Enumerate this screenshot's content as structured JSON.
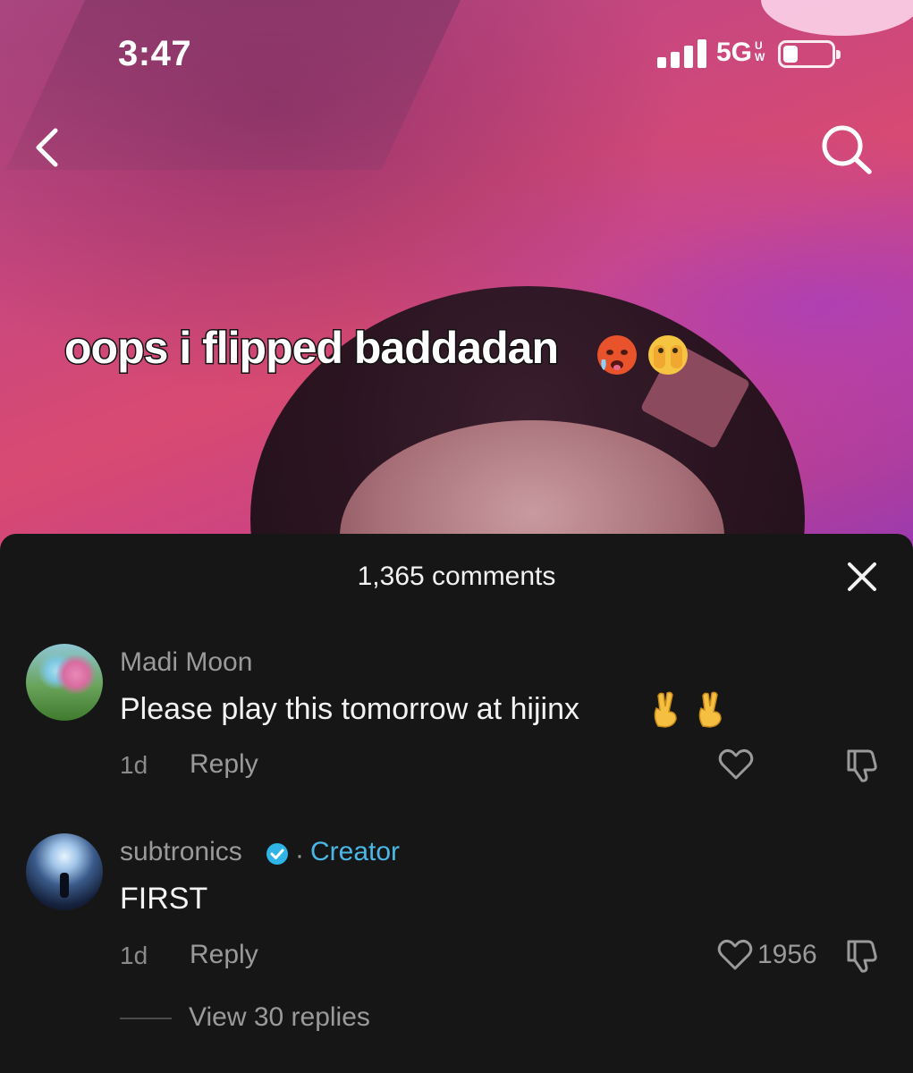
{
  "status_bar": {
    "time": "3:47",
    "network": "5G",
    "network_suffix": "UW",
    "battery_level": 0.3
  },
  "nav": {
    "back_icon": "chevron-left-icon",
    "search_icon": "search-icon"
  },
  "video": {
    "caption": "oops i flipped baddadan",
    "caption_emojis": [
      "hot-face-emoji",
      "face-peeking-emoji"
    ]
  },
  "comments_sheet": {
    "title": "1,365 comments",
    "close_icon": "close-icon",
    "comments": [
      {
        "username": "Madi Moon",
        "text": "Please play this tomorrow at hijinx",
        "emojis": [
          "crossed-fingers-emoji",
          "crossed-fingers-emoji"
        ],
        "time": "1d",
        "reply_label": "Reply",
        "like_count": ""
      },
      {
        "username": "subtronics",
        "verified": true,
        "separator": "·",
        "badge": "Creator",
        "text": "FIRST",
        "time": "1d",
        "reply_label": "Reply",
        "like_count": "1956",
        "view_replies": "View 30 replies"
      }
    ]
  },
  "colors": {
    "sheet_bg": "#161616",
    "creator_blue": "#4bb7e6",
    "muted_text": "#9a9a9a"
  }
}
